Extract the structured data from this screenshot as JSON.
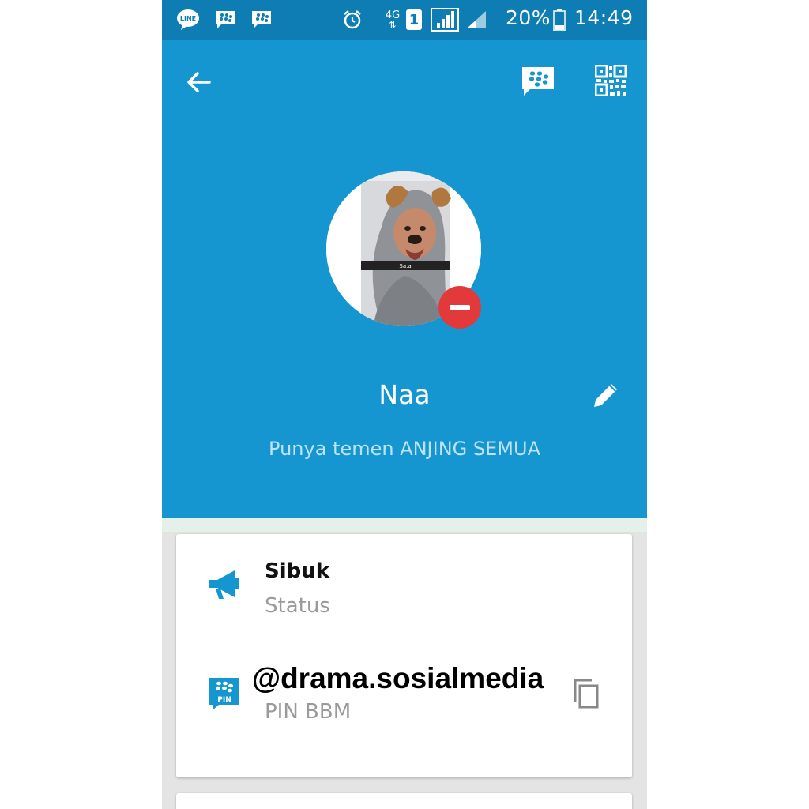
{
  "status_bar": {
    "notification_icons": [
      "line-icon",
      "bbm-icon",
      "bbm-icon"
    ],
    "network": "4G",
    "sim": "1",
    "battery": "20%",
    "time": "14:49"
  },
  "header": {
    "back_icon": "arrow-left-icon",
    "chat_icon": "bbm-chat-icon",
    "qr_icon": "qr-code-icon",
    "name": "Naa",
    "personal_message": "Punya temen ANJING SEMUA",
    "edit_icon": "pencil-icon",
    "accent_color": "#1596d0",
    "remove_badge_color": "#e23a3a"
  },
  "info_card": {
    "status": {
      "value": "Sibuk",
      "label": "Status",
      "icon": "megaphone-icon"
    },
    "pin": {
      "label": "PIN BBM",
      "icon": "bbm-pin-icon",
      "icon_text": "PIN",
      "copy_icon": "copy-icon"
    },
    "watermark": "@drama.sosialmedia"
  },
  "avatar": {
    "caption": "Sa.a"
  }
}
